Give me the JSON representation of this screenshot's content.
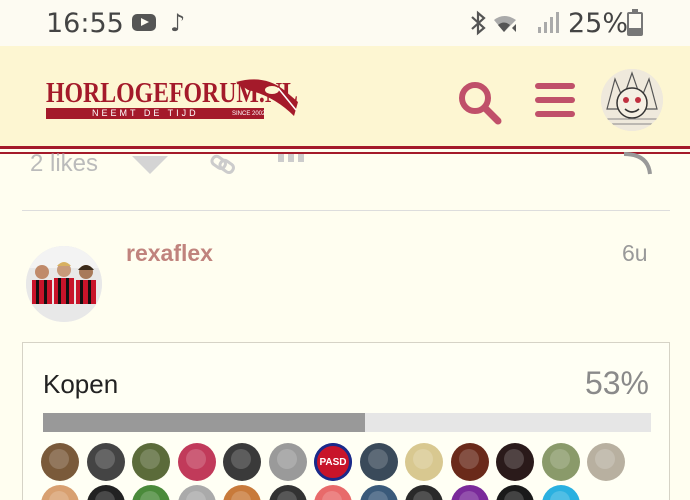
{
  "status_bar": {
    "time": "16:55",
    "battery": "25%"
  },
  "header": {
    "logo_text": "HORLOGEFORUM.NL",
    "logo_tagline": "NEEMT DE TIJD",
    "logo_since": "SINCE 2002",
    "brand_color": "#a41a2a"
  },
  "prev_post": {
    "likes": "2 likes"
  },
  "post": {
    "username": "rexaflex",
    "time": "6u"
  },
  "poll": {
    "option_label": "Kopen",
    "percent_label": "53%",
    "percent_value": 53,
    "voters": [
      {
        "color": "#7a5a3a"
      },
      {
        "color": "#444444"
      },
      {
        "color": "#5b6b3a"
      },
      {
        "color": "#c13a5a"
      },
      {
        "color": "#3a3a3a"
      },
      {
        "color": "#9a9a9a"
      },
      {
        "color": "#c8142a",
        "text": "PASD"
      },
      {
        "color": "#3a4a5a"
      },
      {
        "color": "#d8c890"
      },
      {
        "color": "#6a2a1a"
      },
      {
        "color": "#2a1a1a"
      },
      {
        "color": "#8a9a6a"
      },
      {
        "color": "#b8b0a0"
      },
      {
        "color": "#d8a070"
      },
      {
        "color": "#222222"
      },
      {
        "color": "#4a8a3a"
      },
      {
        "color": "#aaaaaa"
      },
      {
        "color": "#c87a3a"
      },
      {
        "color": "#333333"
      },
      {
        "color": "#e86a6a"
      },
      {
        "color": "#3a5a7a"
      },
      {
        "color": "#2a2a2a"
      },
      {
        "color": "#7a2a9a"
      },
      {
        "color": "#1a1a1a"
      },
      {
        "color": "#2ab0e0"
      }
    ]
  }
}
